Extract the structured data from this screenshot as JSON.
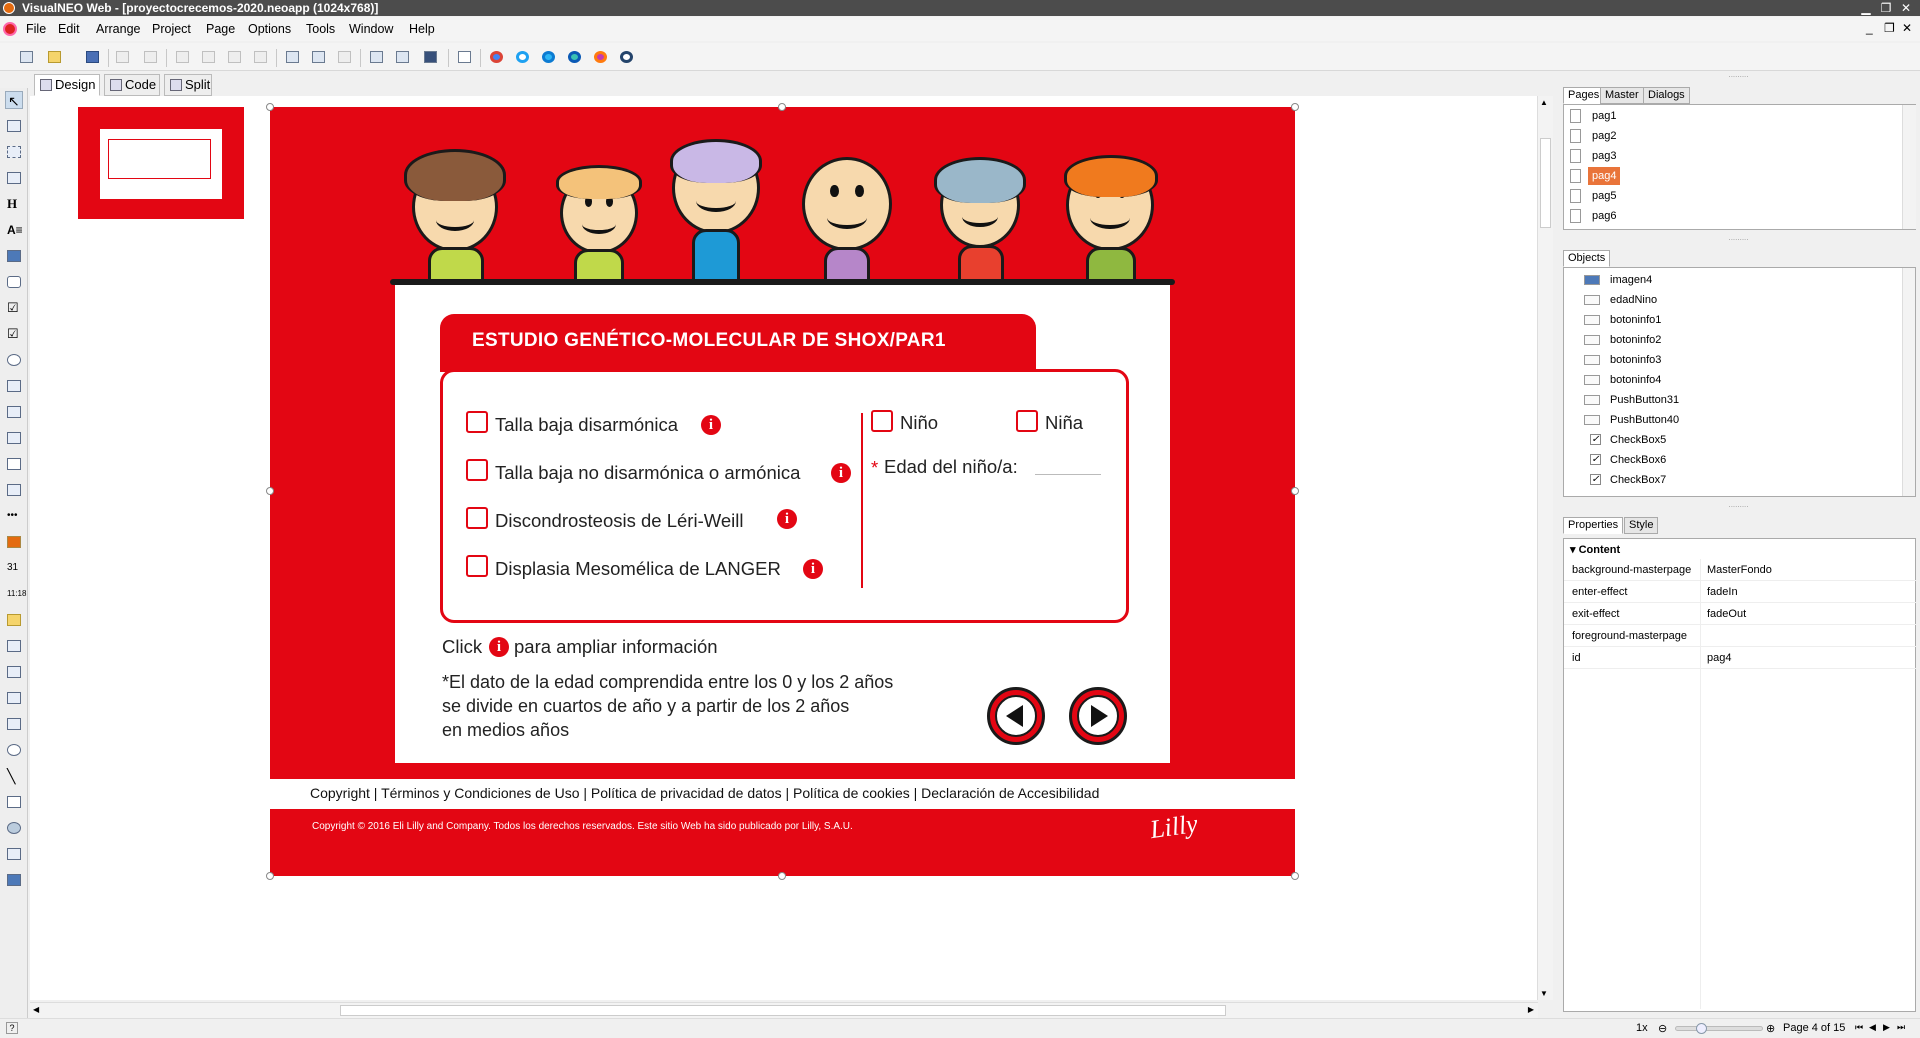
{
  "window": {
    "title": "VisualNEO Web - [proyectocrecemos-2020.neoapp (1024x768)]"
  },
  "menu": [
    "File",
    "Edit",
    "Arrange",
    "Project",
    "Page",
    "Options",
    "Tools",
    "Window",
    "Help"
  ],
  "view_tabs": [
    "Design",
    "Code",
    "Split"
  ],
  "design": {
    "header": "ESTUDIO GENÉTICO-MOLECULAR DE SHOX/PAR1",
    "options": [
      "Talla baja disarmónica",
      "Talla baja no disarmónica o armónica",
      "Discondrosteosis de Léri-Weill",
      "Displasia Mesomélica de LANGER"
    ],
    "gender": [
      "Niño",
      "Niña"
    ],
    "age_asterisk": "*",
    "age_label": "Edad del niño/a:",
    "click_pre": "Click",
    "click_post": "para ampliar información",
    "info_glyph": "i",
    "note_line1": "*El dato de la edad comprendida entre los 0 y los 2 años",
    "note_line2": "se divide en cuartos de año y a partir de los 2 años",
    "note_line3": "en medios años",
    "footer_links": "Copyright | Términos y Condiciones de Uso | Política de privacidad de datos | Política de cookies | Declaración de Accesibilidad",
    "copyright": "Copyright © 2016 Eli Lilly and Company. Todos los derechos reservados. Este sitio Web ha sido publicado por Lilly, S.A.U.",
    "brand": "Lilly"
  },
  "pages_tabs": [
    "Pages",
    "Master",
    "Dialogs"
  ],
  "pages": [
    "pag1",
    "pag2",
    "pag3",
    "pag4",
    "pag5",
    "pag6"
  ],
  "objects_tab": "Objects",
  "objects": [
    "imagen4",
    "edadNino",
    "botoninfo1",
    "botoninfo2",
    "botoninfo3",
    "botoninfo4",
    "PushButton31",
    "PushButton40",
    "CheckBox5",
    "CheckBox6",
    "CheckBox7"
  ],
  "check_mark": "✓",
  "props_tabs": [
    "Properties",
    "Style"
  ],
  "props_section": "Content",
  "properties": [
    {
      "key": "background-masterpage",
      "value": "MasterFondo"
    },
    {
      "key": "enter-effect",
      "value": "fadeIn"
    },
    {
      "key": "exit-effect",
      "value": "fadeOut"
    },
    {
      "key": "foreground-masterpage",
      "value": ""
    },
    {
      "key": "id",
      "value": "pag4"
    }
  ],
  "status": {
    "zoom": "1x",
    "page": "Page 4 of 15"
  },
  "colors": {
    "brand_red": "#e30613",
    "selected_page": "#e9743a"
  }
}
